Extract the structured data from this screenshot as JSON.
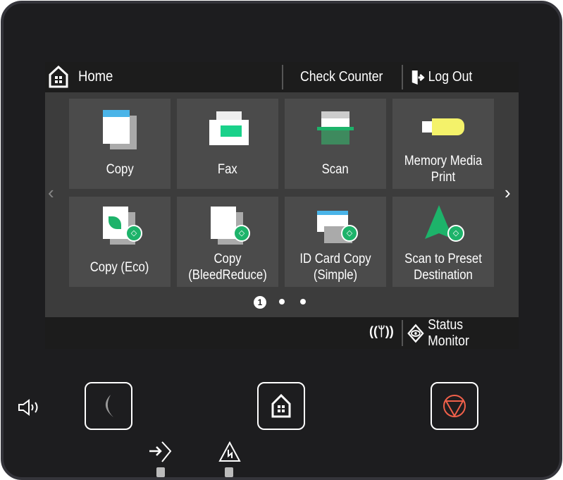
{
  "header": {
    "title": "Home",
    "check_counter": "Check Counter",
    "log_out": "Log Out"
  },
  "tiles": [
    {
      "label": "Copy"
    },
    {
      "label": "Fax"
    },
    {
      "label": "Scan"
    },
    {
      "label": "Memory Media Print"
    },
    {
      "label": "Copy (Eco)"
    },
    {
      "label": "Copy (BleedReduce)"
    },
    {
      "label": "ID Card Copy (Simple)"
    },
    {
      "label": "Scan to Preset Destination"
    }
  ],
  "pagination": {
    "current": "1",
    "total_pages": 3
  },
  "footer": {
    "status_monitor": "Status Monitor",
    "wireless_icon": "wifi-signal-icon"
  },
  "hardware": {
    "energy_saver": "moon-icon",
    "home": "home-icon",
    "stop": "stop-icon",
    "volume": "speaker-icon",
    "data_indicator": "data-arrow-icon",
    "error_indicator": "warning-icon"
  },
  "colors": {
    "accent_green": "#1db36a",
    "stop_red": "#f0604a",
    "memory_yellow": "#f4f26a",
    "blue": "#4ab4e8"
  }
}
